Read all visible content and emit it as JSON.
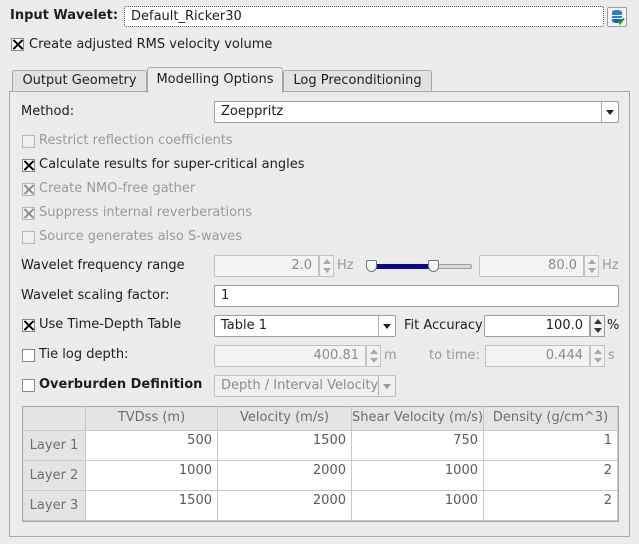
{
  "wavelet": {
    "label": "Input Wavelet:",
    "value": "Default_Ricker30"
  },
  "create_rms": {
    "label": "Create adjusted RMS velocity volume",
    "checked": true
  },
  "tabs": [
    {
      "label": "Output Geometry",
      "active": false
    },
    {
      "label": "Modelling Options",
      "active": true
    },
    {
      "label": "Log Preconditioning",
      "active": false
    }
  ],
  "method": {
    "label": "Method:",
    "value": "Zoeppritz"
  },
  "options": [
    {
      "label": "Restrict reflection coefficients",
      "checked": false,
      "enabled": false
    },
    {
      "label": "Calculate results for super-critical angles",
      "checked": true,
      "enabled": true
    },
    {
      "label": "Create NMO-free gather",
      "checked": true,
      "enabled": false
    },
    {
      "label": "Suppress internal reverberations",
      "checked": true,
      "enabled": false
    },
    {
      "label": "Source generates also S-waves",
      "checked": false,
      "enabled": false
    }
  ],
  "freq": {
    "label": "Wavelet frequency range",
    "min": "2.0",
    "max": "80.0",
    "unit": "Hz",
    "slider_low_fraction": 0.0,
    "slider_high_fraction": 0.65
  },
  "scaling": {
    "label": "Wavelet scaling factor:",
    "value": "1"
  },
  "timedepth": {
    "label": "Use Time-Depth Table",
    "checked": true,
    "table": "Table 1",
    "fit_label": "Fit Accuracy",
    "fit_value": "100.0",
    "fit_unit": "%"
  },
  "tie": {
    "label": "Tie log depth:",
    "checked": false,
    "depth": "400.81",
    "depth_unit": "m",
    "time_label": "to time:",
    "time": "0.444",
    "time_unit": "s"
  },
  "overburden": {
    "label": "Overburden Definition",
    "checked": false,
    "mode": "Depth / Interval Velocity"
  },
  "table": {
    "columns": [
      "TVDss (m)",
      "Velocity (m/s)",
      "Shear Velocity (m/s)",
      "Density (g/cm^3)"
    ],
    "rows": [
      {
        "name": "Layer 1",
        "values": [
          "500",
          "1500",
          "750",
          "1"
        ]
      },
      {
        "name": "Layer 2",
        "values": [
          "1000",
          "2000",
          "1000",
          "2"
        ]
      },
      {
        "name": "Layer 3",
        "values": [
          "1500",
          "2000",
          "1000",
          "2"
        ]
      }
    ]
  },
  "colors": {
    "slider_fill": "#0a0a8a",
    "background": "#ececec"
  },
  "icons": {
    "browse": "database-browse-icon"
  }
}
